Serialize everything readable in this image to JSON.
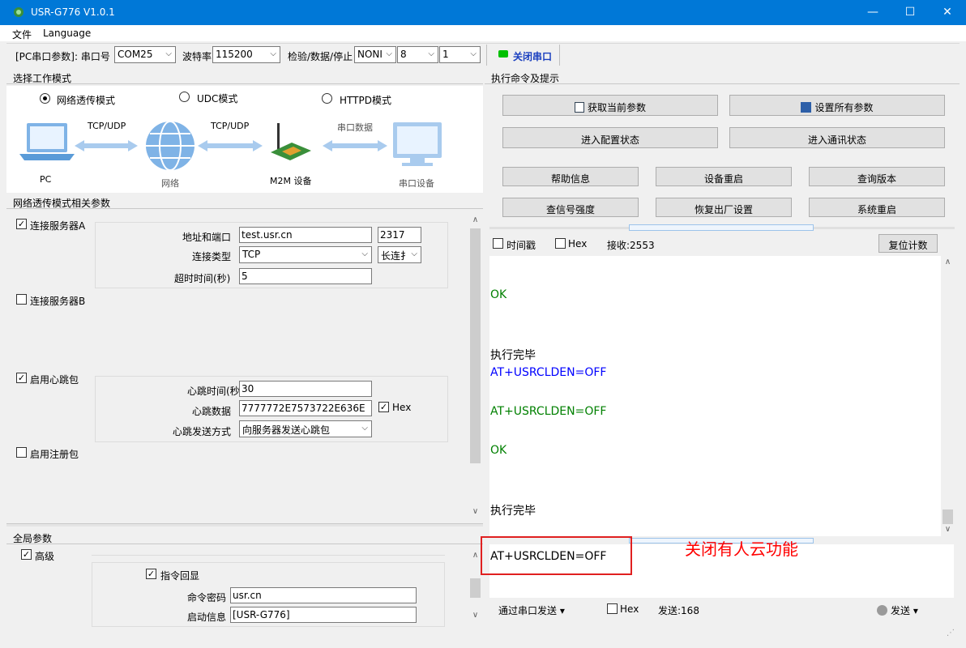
{
  "window": {
    "title": "USR-G776 V1.0.1",
    "minimize": "—",
    "maximize": "☐",
    "close": "✕"
  },
  "menu": {
    "file": "文件",
    "language": "Language"
  },
  "toolbar": {
    "pc_params": "[PC串口参数]",
    "port_label": ": 串口号",
    "port_value": "COM25",
    "baud_label": "波特率",
    "baud_value": "115200",
    "parity_label": "检验/数据/停止",
    "parity_value": "NONI",
    "data_bits": "8",
    "stop_bits": "1",
    "close_port": "关闭串口",
    "status_color": "#00c000"
  },
  "work_mode": {
    "header": "选择工作模式",
    "modes": [
      "网络透传模式",
      "UDC模式",
      "HTTPD模式"
    ],
    "selected": "网络透传模式",
    "diagram": {
      "pc": "PC",
      "link1": "TCP/UDP",
      "network": "网络",
      "link2": "TCP/UDP",
      "device": "M2M 设备",
      "serial_link": "串口数据",
      "serial_device": "串口设备"
    }
  },
  "net_params": {
    "header": "网络透传模式相关参数",
    "server_a": {
      "label": "连接服务器A",
      "checked": true,
      "addr_label": "地址和端口",
      "addr": "test.usr.cn",
      "port": "2317",
      "type_label": "连接类型",
      "type": "TCP",
      "conn": "长连扌",
      "timeout_label": "超时时间(秒)",
      "timeout": "5"
    },
    "server_b": {
      "label": "连接服务器B",
      "checked": false
    },
    "heartbeat": {
      "label": "启用心跳包",
      "checked": true,
      "time_label": "心跳时间(秒",
      "time": "30",
      "data_label": "心跳数据",
      "data": "7777772E7573722E636E",
      "hex": "Hex",
      "hex_checked": true,
      "mode_label": "心跳发送方式",
      "mode": "向服务器发送心跳包"
    },
    "register": {
      "label": "启用注册包",
      "checked": false
    }
  },
  "global_params": {
    "header": "全局参数",
    "advanced": "高级",
    "echo": "指令回显",
    "echo_checked": true,
    "pwd_label": "命令密码",
    "pwd": "usr.cn",
    "boot_label": "启动信息",
    "boot": "[USR-G776]"
  },
  "commands": {
    "header": "执行命令及提示",
    "get_params": "获取当前参数",
    "set_params": "设置所有参数",
    "enter_config": "进入配置状态",
    "enter_comm": "进入通讯状态",
    "help": "帮助信息",
    "reboot_device": "设备重启",
    "query_version": "查询版本",
    "signal": "查信号强度",
    "factory": "恢复出厂设置",
    "system_reboot": "系统重启"
  },
  "log": {
    "timestamp": "时间戳",
    "hex": "Hex",
    "receive": "接收:2553",
    "reset": "复位计数",
    "lines": [
      {
        "text": "OK",
        "color": "green"
      },
      {
        "text": "执行完毕",
        "color": "black"
      },
      {
        "text": "AT+USRCLDEN=OFF",
        "color": "blue"
      },
      {
        "text": "AT+USRCLDEN=OFF",
        "color": "green"
      },
      {
        "text": "OK",
        "color": "green"
      },
      {
        "text": "执行完毕",
        "color": "black"
      }
    ]
  },
  "send": {
    "text": "AT+USRCLDEN=OFF",
    "annotation": "关闭有人云功能",
    "annotation_color": "#ff0000",
    "via": "通过串口发送",
    "hex": "Hex",
    "count": "发送:168",
    "send_btn": "发送"
  }
}
